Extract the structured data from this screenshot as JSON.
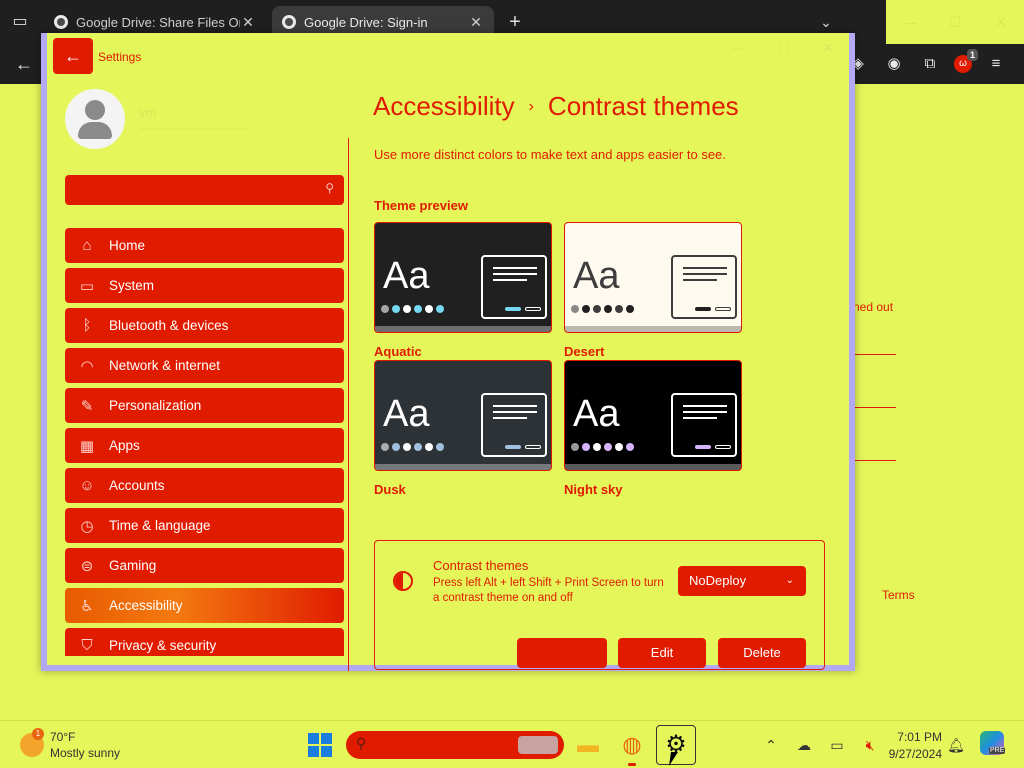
{
  "browser": {
    "tabs": [
      {
        "title": "Google Drive: Share Files Online",
        "active": false
      },
      {
        "title": "Google Drive: Sign-in",
        "active": true
      }
    ],
    "new_tab": "+",
    "background_page": {
      "partial_text": "ned out",
      "terms_link": "Terms"
    },
    "extension_badge": "1"
  },
  "settings": {
    "app_title": "Settings",
    "profile": {
      "name": "vm",
      "email": "——————————"
    },
    "search": {
      "value": "",
      "placeholder": ""
    },
    "nav": [
      {
        "label": "Home",
        "icon": "home-icon"
      },
      {
        "label": "System",
        "icon": "monitor-icon"
      },
      {
        "label": "Bluetooth & devices",
        "icon": "bluetooth-icon"
      },
      {
        "label": "Network & internet",
        "icon": "wifi-icon"
      },
      {
        "label": "Personalization",
        "icon": "brush-icon"
      },
      {
        "label": "Apps",
        "icon": "apps-icon"
      },
      {
        "label": "Accounts",
        "icon": "person-icon"
      },
      {
        "label": "Time & language",
        "icon": "globe-clock-icon"
      },
      {
        "label": "Gaming",
        "icon": "gamepad-icon"
      },
      {
        "label": "Accessibility",
        "icon": "accessibility-icon",
        "selected": true
      },
      {
        "label": "Privacy & security",
        "icon": "shield-icon"
      }
    ],
    "breadcrumb": {
      "parent": "Accessibility",
      "separator": "›",
      "current": "Contrast themes"
    },
    "description": "Use more distinct colors to make text and apps easier to see.",
    "theme_preview_label": "Theme preview",
    "themes": [
      {
        "name": "Aquatic",
        "sample": "Aa",
        "bg": "#202020",
        "fg": "#ffffff",
        "accent": "#75d8f0"
      },
      {
        "name": "Desert",
        "sample": "Aa",
        "bg": "#fffaef",
        "fg": "#3d3d3d",
        "accent": "#202020"
      },
      {
        "name": "Dusk",
        "sample": "Aa",
        "bg": "#2d3236",
        "fg": "#ffffff",
        "accent": "#a1bfde"
      },
      {
        "name": "Night sky",
        "sample": "Aa",
        "bg": "#000000",
        "fg": "#ffffff",
        "accent": "#d6b4fd"
      }
    ],
    "contrast_panel": {
      "title": "Contrast themes",
      "description": "Press left Alt + left Shift + Print Screen to turn a contrast theme on and off",
      "selected_theme": "NoDeploy",
      "apply_label": "",
      "edit_label": "Edit",
      "delete_label": "Delete"
    }
  },
  "taskbar": {
    "weather": {
      "temp": "70°F",
      "condition": "Mostly sunny",
      "badge": "1"
    },
    "clock": {
      "time": "7:01 PM",
      "date": "9/27/2024"
    },
    "copilot_tag": "PRE"
  },
  "colors": {
    "accent": "#e01b00",
    "background": "#e4f65a",
    "selected_nav": "#f47a10",
    "window_border": "#b3a8f2"
  }
}
